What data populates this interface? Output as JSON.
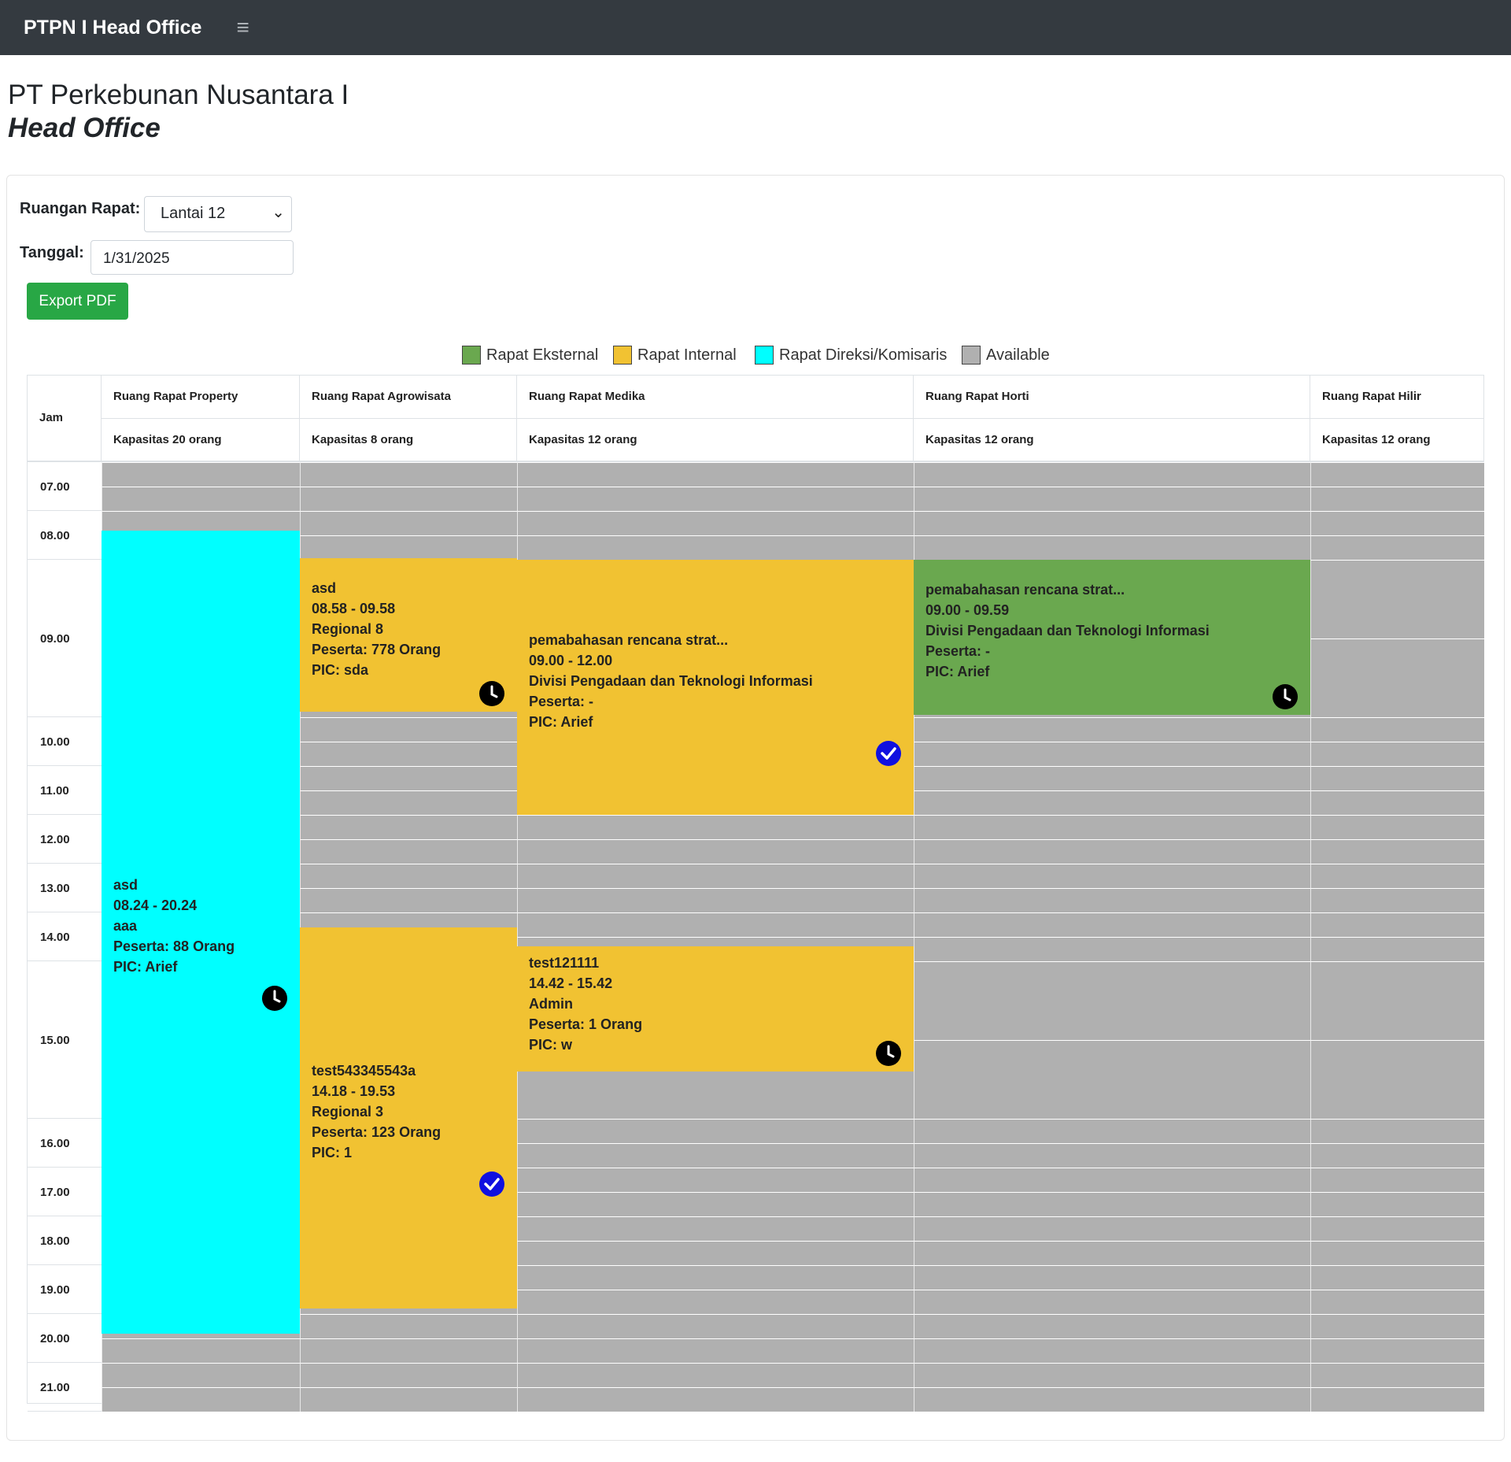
{
  "nav": {
    "brand": "PTPN I Head Office",
    "menu_icon": "hamburger-icon"
  },
  "page": {
    "title": "PT Perkebunan Nusantara I",
    "subtitle": "Head Office"
  },
  "form": {
    "room_label": "Ruangan Rapat:",
    "room_value": "Lantai 12",
    "date_label": "Tanggal:",
    "date_value": "1/31/2025",
    "export_label": "Export PDF"
  },
  "legend": [
    {
      "label": "Rapat Eksternal",
      "color": "#6aa84f"
    },
    {
      "label": "Rapat Internal",
      "color": "#f1c232"
    },
    {
      "label": "Rapat Direksi/Komisaris",
      "color": "#00ffff"
    },
    {
      "label": "Available",
      "color": "#b0b0b0"
    }
  ],
  "table": {
    "time_header": "Jam",
    "rooms": [
      {
        "name": "Ruang Rapat Property",
        "capacity": "Kapasitas 20 orang"
      },
      {
        "name": "Ruang Rapat Agrowisata",
        "capacity": "Kapasitas 8 orang"
      },
      {
        "name": "Ruang Rapat Medika",
        "capacity": "Kapasitas 12 orang"
      },
      {
        "name": "Ruang Rapat Horti",
        "capacity": "Kapasitas 12 orang"
      },
      {
        "name": "Ruang Rapat Hilir",
        "capacity": "Kapasitas 12 orang"
      }
    ],
    "hours": [
      "07.00",
      "08.00",
      "09.00",
      "10.00",
      "11.00",
      "12.00",
      "13.00",
      "14.00",
      "15.00",
      "16.00",
      "17.00",
      "18.00",
      "19.00",
      "20.00",
      "21.00"
    ]
  },
  "events": [
    {
      "room": 0,
      "type": "direksi",
      "color": "#00ffff",
      "title": "asd",
      "time": "08.24 - 20.24",
      "unit": "aaa",
      "peserta": "Peserta: 88 Orang",
      "pic": "PIC: Arief",
      "status": "pending",
      "status_icon": "clock-icon"
    },
    {
      "room": 1,
      "type": "internal",
      "color": "#f1c232",
      "title": "asd",
      "time": "08.58 - 09.58",
      "unit": "Regional 8",
      "peserta": "Peserta: 778 Orang",
      "pic": "PIC: sda",
      "status": "pending",
      "status_icon": "clock-icon"
    },
    {
      "room": 2,
      "type": "internal",
      "color": "#f1c232",
      "title": "pemabahasan rencana strat...",
      "time": "09.00 - 12.00",
      "unit": "Divisi Pengadaan dan Teknologi Informasi",
      "peserta": "Peserta: -",
      "pic": "PIC: Arief",
      "status": "approved",
      "status_icon": "check-circle-icon"
    },
    {
      "room": 3,
      "type": "eksternal",
      "color": "#6aa84f",
      "title": "pemabahasan rencana strat...",
      "time": "09.00 - 09.59",
      "unit": "Divisi Pengadaan dan Teknologi Informasi",
      "peserta": "Peserta: -",
      "pic": "PIC: Arief",
      "status": "pending",
      "status_icon": "clock-icon"
    },
    {
      "room": 2,
      "type": "internal",
      "color": "#f1c232",
      "title": "test121111",
      "time": "14.42 - 15.42",
      "unit": "Admin",
      "peserta": "Peserta: 1 Orang",
      "pic": "PIC: w",
      "status": "pending",
      "status_icon": "clock-icon"
    },
    {
      "room": 1,
      "type": "internal",
      "color": "#f1c232",
      "title": "test543345543a",
      "time": "14.18 - 19.53",
      "unit": "Regional 3",
      "peserta": "Peserta: 123 Orang",
      "pic": "PIC: 1",
      "status": "approved",
      "status_icon": "check-circle-icon"
    }
  ]
}
